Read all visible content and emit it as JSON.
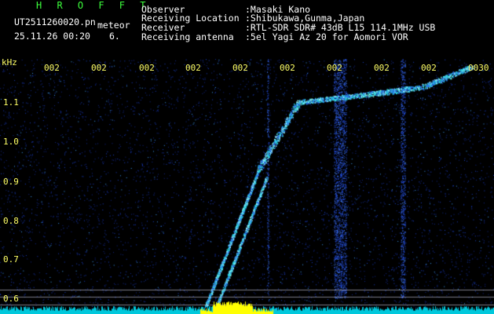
{
  "header": {
    "program": "H R O F F T",
    "filename": "UT2511260020.pn",
    "tag": "meteor",
    "datetime": "25.11.26 00:20",
    "count": "6.",
    "labels": {
      "observer": "Observer",
      "location": "Receiving Location",
      "receiver": "Receiver",
      "antenna": "Receiving antenna"
    },
    "values": {
      "observer": ":Masaki Kano",
      "location": ":Shibukawa,Gunma,Japan",
      "receiver": ":RTL-SDR SDR# 43dB L15 114.1MHz USB",
      "antenna": ":5el Yagi Az 20 for Aomori VOR"
    }
  },
  "axis": {
    "unit": "kHz",
    "freq_labels": [
      "1.1",
      "1.0",
      "0.9",
      "0.8",
      "0.7",
      "0.6"
    ],
    "time_labels": [
      "002",
      "002",
      "002",
      "002",
      "002",
      "002",
      "002",
      "002",
      "002",
      "0030"
    ]
  },
  "colors": {
    "background": "#000000",
    "noise": "#1a3cc8",
    "signal": "#28e6e6",
    "baseline": "#00d0e0",
    "burst": "#ffff00",
    "axis_text": "#ffff66",
    "title": "#3cff3c"
  }
}
